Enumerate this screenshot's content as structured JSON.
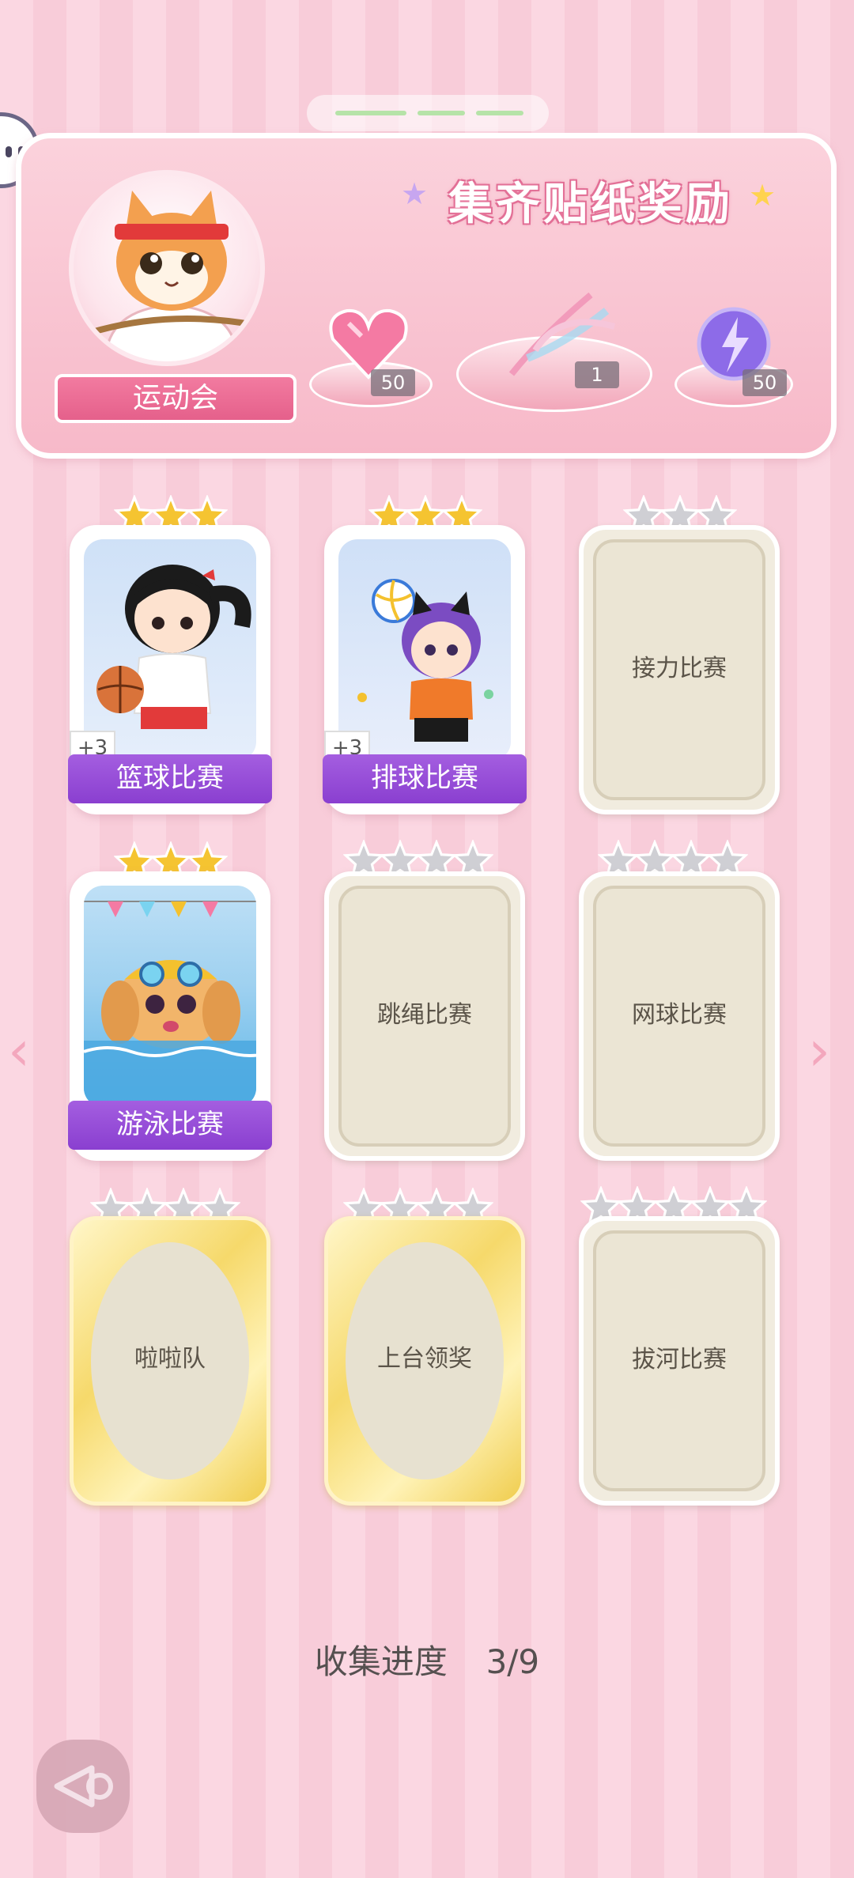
{
  "banner": {
    "title": "集齐贴纸奖励",
    "event_label": "运动会",
    "rewards": [
      {
        "icon": "heart-gem-icon",
        "count": "50"
      },
      {
        "icon": "crystal-feather-icon",
        "count": "1"
      },
      {
        "icon": "lightning-orb-icon",
        "count": "50"
      }
    ]
  },
  "cards": [
    {
      "name": "篮球比赛",
      "state": "unlocked",
      "stars": 3,
      "bonus": "+3",
      "art": "basketball-girl"
    },
    {
      "name": "排球比赛",
      "state": "unlocked",
      "stars": 3,
      "bonus": "+3",
      "art": "volleyball-girl"
    },
    {
      "name": "接力比赛",
      "state": "locked",
      "stars": 3
    },
    {
      "name": "游泳比赛",
      "state": "unlocked",
      "stars": 3,
      "art": "swimming-dog"
    },
    {
      "name": "跳绳比赛",
      "state": "locked",
      "stars": 4
    },
    {
      "name": "网球比赛",
      "state": "locked",
      "stars": 4
    },
    {
      "name": "啦啦队",
      "state": "locked-gold",
      "stars": 4
    },
    {
      "name": "上台领奖",
      "state": "locked-gold",
      "stars": 4
    },
    {
      "name": "拔河比赛",
      "state": "locked",
      "stars": 5
    }
  ],
  "progress": {
    "label": "收集进度",
    "value": "3/9"
  },
  "colors": {
    "gold_star": "#f5c431",
    "silver_star": "#cfcfd4",
    "purple_label": "#9a52da",
    "pink_bg": "#fbd7e2"
  }
}
